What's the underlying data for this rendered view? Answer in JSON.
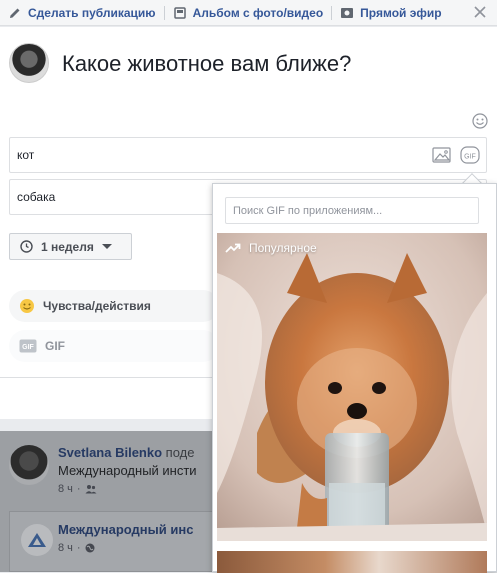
{
  "topbar": {
    "items": [
      {
        "label": "Сделать публикацию",
        "icon": "pencil-icon"
      },
      {
        "label": "Альбом с фото/видео",
        "icon": "album-icon"
      },
      {
        "label": "Прямой эфир",
        "icon": "video-camera-icon"
      }
    ],
    "close_icon": "close-icon"
  },
  "composer": {
    "question": "Какое животное вам ближе?",
    "options": [
      "кот",
      "собака"
    ],
    "duration_label": "1 неделя",
    "actions": [
      {
        "label": "Чувства/действия",
        "icon": "smiley-icon"
      },
      {
        "label": "GIF",
        "icon": "gif-icon"
      }
    ]
  },
  "gif_picker": {
    "search_placeholder": "Поиск GIF по приложениям...",
    "popular_label": "Популярное"
  },
  "feed": {
    "post": {
      "author": "Svetlana Bilenko",
      "author_suffix": " поде",
      "subtitle": "Международный инсти",
      "time": "8 ч"
    },
    "shared": {
      "page_name": "Международный инс",
      "time": "8 ч"
    }
  },
  "colors": {
    "link": "#365899",
    "text": "#1d2129",
    "muted": "#90949c",
    "emoji_yellow": "#f7c744"
  }
}
